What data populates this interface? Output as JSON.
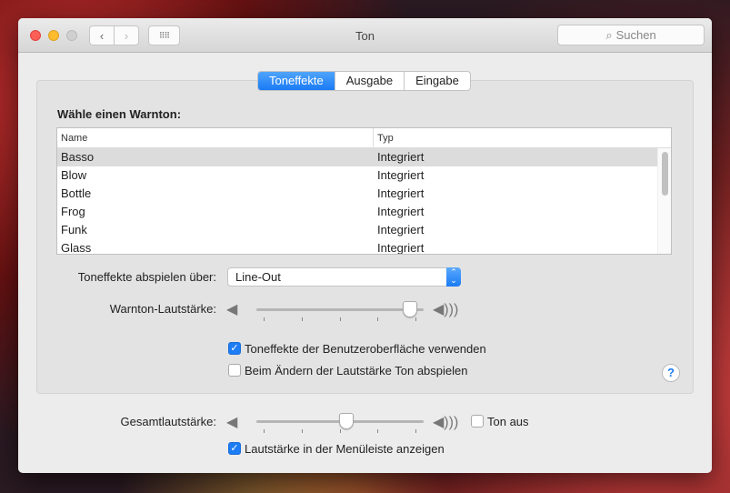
{
  "window": {
    "title": "Ton",
    "search_placeholder": "Suchen"
  },
  "tabs": [
    {
      "label": "Toneffekte",
      "active": true
    },
    {
      "label": "Ausgabe"
    },
    {
      "label": "Eingabe"
    }
  ],
  "alert": {
    "heading": "Wähle einen Warnton:",
    "columns": [
      "Name",
      "Typ"
    ],
    "rows": [
      {
        "name": "Basso",
        "type": "Integriert",
        "selected": true
      },
      {
        "name": "Blow",
        "type": "Integriert"
      },
      {
        "name": "Bottle",
        "type": "Integriert"
      },
      {
        "name": "Frog",
        "type": "Integriert"
      },
      {
        "name": "Funk",
        "type": "Integriert"
      },
      {
        "name": "Glass",
        "type": "Integriert"
      }
    ]
  },
  "play_via": {
    "label": "Toneffekte abspielen über:",
    "value": "Line-Out"
  },
  "alert_volume": {
    "label": "Warnton-Lautstärke:",
    "value": 0.96
  },
  "checkboxes": [
    {
      "label": "Toneffekte der Benutzeroberfläche verwenden",
      "checked": true
    },
    {
      "label": "Beim Ändern der Lautstärke Ton abspielen",
      "checked": false
    }
  ],
  "help": "?",
  "output_volume": {
    "label": "Gesamtlautstärke:",
    "value": 0.54,
    "mute_label": "Ton aus",
    "mute": false
  },
  "menubar_checkbox": {
    "label": "Lautstärke in der Menüleiste anzeigen",
    "checked": true
  },
  "colors": {
    "accent": "#1a7bf5"
  }
}
